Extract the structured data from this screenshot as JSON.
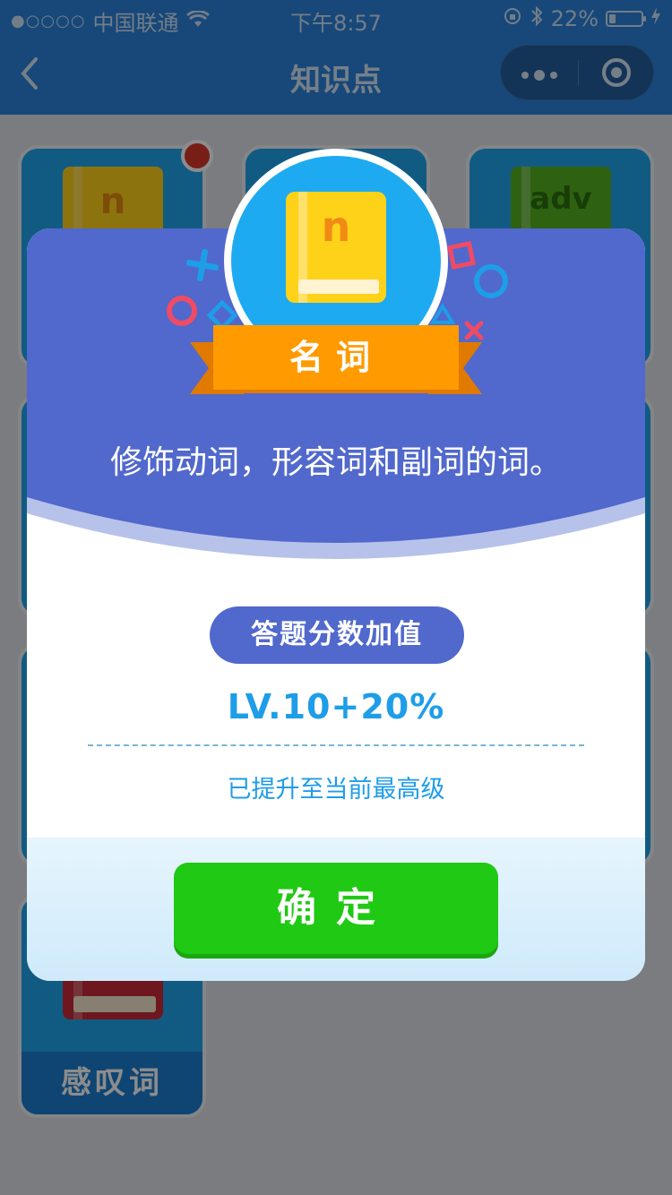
{
  "status_bar": {
    "signal": "●○○○○",
    "carrier": "中国联通",
    "time": "下午8:57",
    "battery_percent": "22%",
    "battery_level": 0.22,
    "icons": [
      "wifi-icon",
      "rotation-lock-icon",
      "bluetooth-icon",
      "battery-icon",
      "charging-icon"
    ]
  },
  "nav": {
    "title": "知识点",
    "back_icon": "chevron-left-icon",
    "more_icon": "more-dots-icon",
    "close_icon": "target-close-icon"
  },
  "grid": {
    "cards": [
      {
        "letter": "n",
        "label": "",
        "color": "#ffd21a"
      },
      {
        "letter": "",
        "label": "",
        "color": "#1fa6ee"
      },
      {
        "letter": "adv",
        "label": "",
        "color": "#54b320"
      },
      {
        "letter": "",
        "label": "感叹词",
        "color": "#c92a3a"
      }
    ]
  },
  "modal": {
    "badge": {
      "book_letter": "n",
      "ribbon_title": "名词"
    },
    "description": "修饰动词，形容词和副词的词。",
    "score_label": "答题分数加值",
    "level_text": "LV.10+20%",
    "upgrade_note": "已提升至当前最高级",
    "confirm_label": "确定"
  },
  "colors": {
    "nav": "#2a83dd",
    "modal_header": "#5168cc",
    "accent_blue": "#1e9de8",
    "confirm_green": "#20c914",
    "ribbon_orange": "#ff9a00"
  }
}
